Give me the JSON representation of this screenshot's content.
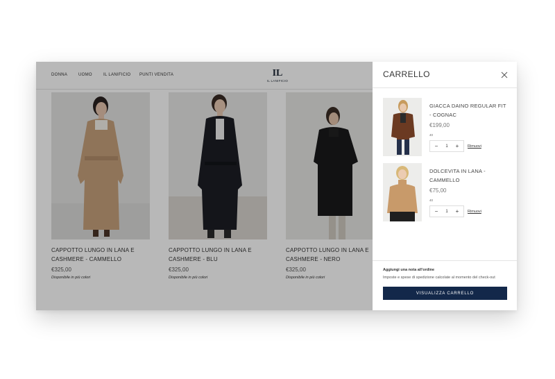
{
  "nav": {
    "links": [
      "DONNA",
      "UOMO",
      "IL LANIFICIO",
      "PUNTI VENDITA"
    ],
    "logo_mark": "IL",
    "logo_text": "IL LANIFICIO"
  },
  "products": [
    {
      "name": "CAPPOTTO LUNGO IN LANA E CASHMERE - CAMMELLO",
      "price": "€325,00",
      "availability": "Disponibile in più colori"
    },
    {
      "name": "CAPPOTTO LUNGO IN LANA E CASHMERE - BLU",
      "price": "€325,00",
      "availability": "Disponibile in più colori"
    },
    {
      "name": "CAPPOTTO LUNGO IN LANA E CASHMERE - NERO",
      "price": "€325,00",
      "availability": "Disponibile in più colori"
    }
  ],
  "cart": {
    "title": "CARRELLO",
    "items": [
      {
        "name": "GIACCA DAINO REGULAR FIT - COGNAC",
        "price": "€199,00",
        "size": "40",
        "quantity": "1",
        "remove_label": "Rimuovi"
      },
      {
        "name": "DOLCEVITA IN LANA - CAMMELLO",
        "price": "€75,00",
        "size": "40",
        "quantity": "1",
        "remove_label": "Rimuovi"
      }
    ],
    "note_label": "Aggiungi una nota all'ordine",
    "shipping_text": "Imposte e spese di spedizione calcolate al momento del check-out",
    "checkout_label": "VISUALIZZA CARRELLO"
  },
  "colors": {
    "accent": "#13284a",
    "overlay": "rgba(0,0,0,0.28)"
  }
}
